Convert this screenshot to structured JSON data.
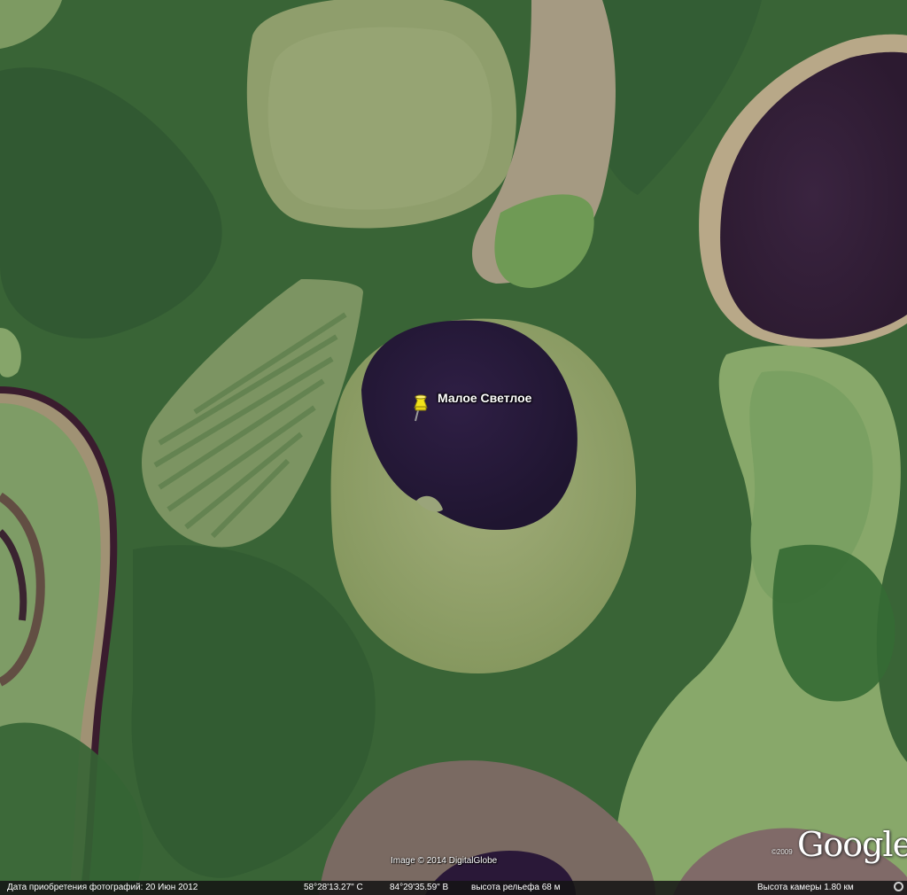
{
  "map": {
    "type": "satellite",
    "colors": {
      "forest": "#3f6a3a",
      "lake": "#2a1a3a",
      "bog": "#8b9a6a"
    }
  },
  "placemark": {
    "icon": "yellow-pushpin-icon",
    "color": "#f2e21a",
    "label": "Малое Светлое"
  },
  "copyright": "Image © 2014 DigitalGlobe",
  "logo": {
    "year": "©2009",
    "text": "Google"
  },
  "statusbar": {
    "capture_date": "Дата приобретения фотографий: 20 Июн 2012",
    "latitude": "58°28'13.27\" С",
    "longitude": "84°29'35.59\" В",
    "elevation": "высота рельефа   68 м",
    "eye_altitude": "Высота камеры    1.80 км",
    "status_icon": "streaming-status-icon"
  }
}
